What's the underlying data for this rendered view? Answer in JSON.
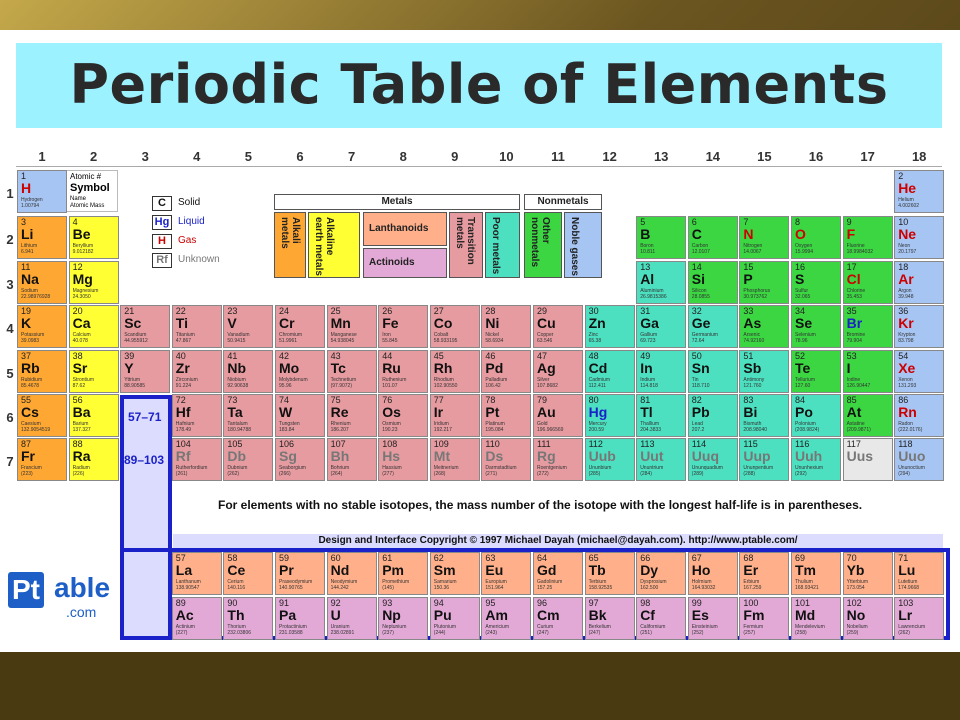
{
  "title": "Periodic Table of Elements",
  "groups": [
    "1",
    "2",
    "3",
    "4",
    "5",
    "6",
    "7",
    "8",
    "9",
    "10",
    "11",
    "12",
    "13",
    "14",
    "15",
    "16",
    "17",
    "18"
  ],
  "periods": [
    "1",
    "2",
    "3",
    "4",
    "5",
    "6",
    "7"
  ],
  "key": {
    "num": "Atomic #",
    "sym": "Symbol",
    "name": "Name",
    "mass": "Atomic Mass"
  },
  "states": [
    {
      "sym": "C",
      "label": "Solid",
      "color": "#111111"
    },
    {
      "sym": "Hg",
      "label": "Liquid",
      "color": "#1a21c8"
    },
    {
      "sym": "H",
      "label": "Gas",
      "color": "#cc0000"
    },
    {
      "sym": "Rf",
      "label": "Unknown",
      "color": "#777777"
    }
  ],
  "legend": {
    "metals": "Metals",
    "nonmetals": "Nonmetals",
    "alkali": "Alkali metals",
    "alkaline": "Alkaline earth metals",
    "lanthanoids": "Lanthanoids",
    "actinoids": "Actinoids",
    "transition": "Transition metals",
    "poor": "Poor metals",
    "other": "Other nonmetals",
    "noble": "Noble gases"
  },
  "lanthanide_range": "57–71",
  "actinide_range": "89–103",
  "note": "For elements with no stable isotopes, the mass number of the isotope with the longest half-life is in parentheses.",
  "copyright": "Design and Interface Copyright © 1997 Michael Dayah (michael@dayah.com). http://www.ptable.com/",
  "logo": {
    "pt": "Pt",
    "able": "able",
    "com": ".com"
  },
  "elements": [
    {
      "n": "1",
      "s": "H",
      "nm": "Hydrogen",
      "m": "1.00794",
      "g": 1,
      "p": 1,
      "c": "ng"
    },
    {
      "n": "2",
      "s": "He",
      "nm": "Helium",
      "m": "4.002602",
      "g": 18,
      "p": 1,
      "c": "ng"
    },
    {
      "n": "3",
      "s": "Li",
      "nm": "Lithium",
      "m": "6.941",
      "g": 1,
      "p": 2,
      "c": "alk"
    },
    {
      "n": "4",
      "s": "Be",
      "nm": "Beryllium",
      "m": "9.012182",
      "g": 2,
      "p": 2,
      "c": "ae"
    },
    {
      "n": "5",
      "s": "B",
      "nm": "Boron",
      "m": "10.811",
      "g": 13,
      "p": 2,
      "c": "nm2"
    },
    {
      "n": "6",
      "s": "C",
      "nm": "Carbon",
      "m": "12.0107",
      "g": 14,
      "p": 2,
      "c": "nm2"
    },
    {
      "n": "7",
      "s": "N",
      "nm": "Nitrogen",
      "m": "14.0067",
      "g": 15,
      "p": 2,
      "c": "nm2"
    },
    {
      "n": "8",
      "s": "O",
      "nm": "Oxygen",
      "m": "15.9994",
      "g": 16,
      "p": 2,
      "c": "nm2"
    },
    {
      "n": "9",
      "s": "F",
      "nm": "Fluorine",
      "m": "18.9984032",
      "g": 17,
      "p": 2,
      "c": "nm2"
    },
    {
      "n": "10",
      "s": "Ne",
      "nm": "Neon",
      "m": "20.1797",
      "g": 18,
      "p": 2,
      "c": "ng"
    },
    {
      "n": "11",
      "s": "Na",
      "nm": "Sodium",
      "m": "22.98976928",
      "g": 1,
      "p": 3,
      "c": "alk"
    },
    {
      "n": "12",
      "s": "Mg",
      "nm": "Magnesium",
      "m": "24.3050",
      "g": 2,
      "p": 3,
      "c": "ae"
    },
    {
      "n": "13",
      "s": "Al",
      "nm": "Aluminium",
      "m": "26.9815386",
      "g": 13,
      "p": 3,
      "c": "pm"
    },
    {
      "n": "14",
      "s": "Si",
      "nm": "Silicon",
      "m": "28.0855",
      "g": 14,
      "p": 3,
      "c": "nm2"
    },
    {
      "n": "15",
      "s": "P",
      "nm": "Phosphorus",
      "m": "30.973762",
      "g": 15,
      "p": 3,
      "c": "nm2"
    },
    {
      "n": "16",
      "s": "S",
      "nm": "Sulfur",
      "m": "32.065",
      "g": 16,
      "p": 3,
      "c": "nm2"
    },
    {
      "n": "17",
      "s": "Cl",
      "nm": "Chlorine",
      "m": "35.453",
      "g": 17,
      "p": 3,
      "c": "nm2"
    },
    {
      "n": "18",
      "s": "Ar",
      "nm": "Argon",
      "m": "39.948",
      "g": 18,
      "p": 3,
      "c": "ng"
    },
    {
      "n": "19",
      "s": "K",
      "nm": "Potassium",
      "m": "39.0983",
      "g": 1,
      "p": 4,
      "c": "alk"
    },
    {
      "n": "20",
      "s": "Ca",
      "nm": "Calcium",
      "m": "40.078",
      "g": 2,
      "p": 4,
      "c": "ae"
    },
    {
      "n": "21",
      "s": "Sc",
      "nm": "Scandium",
      "m": "44.955912",
      "g": 3,
      "p": 4,
      "c": "tm"
    },
    {
      "n": "22",
      "s": "Ti",
      "nm": "Titanium",
      "m": "47.867",
      "g": 4,
      "p": 4,
      "c": "tm"
    },
    {
      "n": "23",
      "s": "V",
      "nm": "Vanadium",
      "m": "50.9415",
      "g": 5,
      "p": 4,
      "c": "tm"
    },
    {
      "n": "24",
      "s": "Cr",
      "nm": "Chromium",
      "m": "51.9961",
      "g": 6,
      "p": 4,
      "c": "tm"
    },
    {
      "n": "25",
      "s": "Mn",
      "nm": "Manganese",
      "m": "54.938045",
      "g": 7,
      "p": 4,
      "c": "tm"
    },
    {
      "n": "26",
      "s": "Fe",
      "nm": "Iron",
      "m": "55.845",
      "g": 8,
      "p": 4,
      "c": "tm"
    },
    {
      "n": "27",
      "s": "Co",
      "nm": "Cobalt",
      "m": "58.933195",
      "g": 9,
      "p": 4,
      "c": "tm"
    },
    {
      "n": "28",
      "s": "Ni",
      "nm": "Nickel",
      "m": "58.6934",
      "g": 10,
      "p": 4,
      "c": "tm"
    },
    {
      "n": "29",
      "s": "Cu",
      "nm": "Copper",
      "m": "63.546",
      "g": 11,
      "p": 4,
      "c": "tm"
    },
    {
      "n": "30",
      "s": "Zn",
      "nm": "Zinc",
      "m": "65.38",
      "g": 12,
      "p": 4,
      "c": "pm"
    },
    {
      "n": "31",
      "s": "Ga",
      "nm": "Gallium",
      "m": "69.723",
      "g": 13,
      "p": 4,
      "c": "pm"
    },
    {
      "n": "32",
      "s": "Ge",
      "nm": "Germanium",
      "m": "72.64",
      "g": 14,
      "p": 4,
      "c": "pm"
    },
    {
      "n": "33",
      "s": "As",
      "nm": "Arsenic",
      "m": "74.92160",
      "g": 15,
      "p": 4,
      "c": "nm2"
    },
    {
      "n": "34",
      "s": "Se",
      "nm": "Selenium",
      "m": "78.96",
      "g": 16,
      "p": 4,
      "c": "nm2"
    },
    {
      "n": "35",
      "s": "Br",
      "nm": "Bromine",
      "m": "79.904",
      "g": 17,
      "p": 4,
      "c": "nm2"
    },
    {
      "n": "36",
      "s": "Kr",
      "nm": "Krypton",
      "m": "83.798",
      "g": 18,
      "p": 4,
      "c": "ng"
    },
    {
      "n": "37",
      "s": "Rb",
      "nm": "Rubidium",
      "m": "85.4678",
      "g": 1,
      "p": 5,
      "c": "alk"
    },
    {
      "n": "38",
      "s": "Sr",
      "nm": "Strontium",
      "m": "87.62",
      "g": 2,
      "p": 5,
      "c": "ae"
    },
    {
      "n": "39",
      "s": "Y",
      "nm": "Yttrium",
      "m": "88.90585",
      "g": 3,
      "p": 5,
      "c": "tm"
    },
    {
      "n": "40",
      "s": "Zr",
      "nm": "Zirconium",
      "m": "91.224",
      "g": 4,
      "p": 5,
      "c": "tm"
    },
    {
      "n": "41",
      "s": "Nb",
      "nm": "Niobium",
      "m": "92.90638",
      "g": 5,
      "p": 5,
      "c": "tm"
    },
    {
      "n": "42",
      "s": "Mo",
      "nm": "Molybdenum",
      "m": "95.96",
      "g": 6,
      "p": 5,
      "c": "tm"
    },
    {
      "n": "43",
      "s": "Tc",
      "nm": "Technetium",
      "m": "(97.9072)",
      "g": 7,
      "p": 5,
      "c": "tm"
    },
    {
      "n": "44",
      "s": "Ru",
      "nm": "Ruthenium",
      "m": "101.07",
      "g": 8,
      "p": 5,
      "c": "tm"
    },
    {
      "n": "45",
      "s": "Rh",
      "nm": "Rhodium",
      "m": "102.90550",
      "g": 9,
      "p": 5,
      "c": "tm"
    },
    {
      "n": "46",
      "s": "Pd",
      "nm": "Palladium",
      "m": "106.42",
      "g": 10,
      "p": 5,
      "c": "tm"
    },
    {
      "n": "47",
      "s": "Ag",
      "nm": "Silver",
      "m": "107.8682",
      "g": 11,
      "p": 5,
      "c": "tm"
    },
    {
      "n": "48",
      "s": "Cd",
      "nm": "Cadmium",
      "m": "112.411",
      "g": 12,
      "p": 5,
      "c": "pm"
    },
    {
      "n": "49",
      "s": "In",
      "nm": "Indium",
      "m": "114.818",
      "g": 13,
      "p": 5,
      "c": "pm"
    },
    {
      "n": "50",
      "s": "Sn",
      "nm": "Tin",
      "m": "118.710",
      "g": 14,
      "p": 5,
      "c": "pm"
    },
    {
      "n": "51",
      "s": "Sb",
      "nm": "Antimony",
      "m": "121.760",
      "g": 15,
      "p": 5,
      "c": "pm"
    },
    {
      "n": "52",
      "s": "Te",
      "nm": "Tellurium",
      "m": "127.60",
      "g": 16,
      "p": 5,
      "c": "nm2"
    },
    {
      "n": "53",
      "s": "I",
      "nm": "Iodine",
      "m": "126.90447",
      "g": 17,
      "p": 5,
      "c": "nm2"
    },
    {
      "n": "54",
      "s": "Xe",
      "nm": "Xenon",
      "m": "131.293",
      "g": 18,
      "p": 5,
      "c": "ng"
    },
    {
      "n": "55",
      "s": "Cs",
      "nm": "Caesium",
      "m": "132.9054519",
      "g": 1,
      "p": 6,
      "c": "alk"
    },
    {
      "n": "56",
      "s": "Ba",
      "nm": "Barium",
      "m": "137.327",
      "g": 2,
      "p": 6,
      "c": "ae"
    },
    {
      "n": "72",
      "s": "Hf",
      "nm": "Hafnium",
      "m": "178.49",
      "g": 4,
      "p": 6,
      "c": "tm"
    },
    {
      "n": "73",
      "s": "Ta",
      "nm": "Tantalum",
      "m": "180.94788",
      "g": 5,
      "p": 6,
      "c": "tm"
    },
    {
      "n": "74",
      "s": "W",
      "nm": "Tungsten",
      "m": "183.84",
      "g": 6,
      "p": 6,
      "c": "tm"
    },
    {
      "n": "75",
      "s": "Re",
      "nm": "Rhenium",
      "m": "186.207",
      "g": 7,
      "p": 6,
      "c": "tm"
    },
    {
      "n": "76",
      "s": "Os",
      "nm": "Osmium",
      "m": "190.23",
      "g": 8,
      "p": 6,
      "c": "tm"
    },
    {
      "n": "77",
      "s": "Ir",
      "nm": "Iridium",
      "m": "192.217",
      "g": 9,
      "p": 6,
      "c": "tm"
    },
    {
      "n": "78",
      "s": "Pt",
      "nm": "Platinum",
      "m": "195.084",
      "g": 10,
      "p": 6,
      "c": "tm"
    },
    {
      "n": "79",
      "s": "Au",
      "nm": "Gold",
      "m": "196.966569",
      "g": 11,
      "p": 6,
      "c": "tm"
    },
    {
      "n": "80",
      "s": "Hg",
      "nm": "Mercury",
      "m": "200.59",
      "g": 12,
      "p": 6,
      "c": "pm"
    },
    {
      "n": "81",
      "s": "Tl",
      "nm": "Thallium",
      "m": "204.3833",
      "g": 13,
      "p": 6,
      "c": "pm"
    },
    {
      "n": "82",
      "s": "Pb",
      "nm": "Lead",
      "m": "207.2",
      "g": 14,
      "p": 6,
      "c": "pm"
    },
    {
      "n": "83",
      "s": "Bi",
      "nm": "Bismuth",
      "m": "208.98040",
      "g": 15,
      "p": 6,
      "c": "pm"
    },
    {
      "n": "84",
      "s": "Po",
      "nm": "Polonium",
      "m": "(208.9824)",
      "g": 16,
      "p": 6,
      "c": "pm"
    },
    {
      "n": "85",
      "s": "At",
      "nm": "Astatine",
      "m": "(209.9871)",
      "g": 17,
      "p": 6,
      "c": "nm2"
    },
    {
      "n": "86",
      "s": "Rn",
      "nm": "Radon",
      "m": "(222.0176)",
      "g": 18,
      "p": 6,
      "c": "ng"
    },
    {
      "n": "87",
      "s": "Fr",
      "nm": "Francium",
      "m": "(223)",
      "g": 1,
      "p": 7,
      "c": "alk"
    },
    {
      "n": "88",
      "s": "Ra",
      "nm": "Radium",
      "m": "(226)",
      "g": 2,
      "p": 7,
      "c": "ae"
    },
    {
      "n": "104",
      "s": "Rf",
      "nm": "Rutherfordium",
      "m": "(261)",
      "g": 4,
      "p": 7,
      "c": "tm"
    },
    {
      "n": "105",
      "s": "Db",
      "nm": "Dubnium",
      "m": "(262)",
      "g": 5,
      "p": 7,
      "c": "tm"
    },
    {
      "n": "106",
      "s": "Sg",
      "nm": "Seaborgium",
      "m": "(266)",
      "g": 6,
      "p": 7,
      "c": "tm"
    },
    {
      "n": "107",
      "s": "Bh",
      "nm": "Bohrium",
      "m": "(264)",
      "g": 7,
      "p": 7,
      "c": "tm"
    },
    {
      "n": "108",
      "s": "Hs",
      "nm": "Hassium",
      "m": "(277)",
      "g": 8,
      "p": 7,
      "c": "tm"
    },
    {
      "n": "109",
      "s": "Mt",
      "nm": "Meitnerium",
      "m": "(268)",
      "g": 9,
      "p": 7,
      "c": "tm"
    },
    {
      "n": "110",
      "s": "Ds",
      "nm": "Darmstadtium",
      "m": "(271)",
      "g": 10,
      "p": 7,
      "c": "tm"
    },
    {
      "n": "111",
      "s": "Rg",
      "nm": "Roentgenium",
      "m": "(272)",
      "g": 11,
      "p": 7,
      "c": "tm"
    },
    {
      "n": "112",
      "s": "Uub",
      "nm": "Ununbium",
      "m": "(285)",
      "g": 12,
      "p": 7,
      "c": "pm"
    },
    {
      "n": "113",
      "s": "Uut",
      "nm": "Ununtrium",
      "m": "(284)",
      "g": 13,
      "p": 7,
      "c": "pm"
    },
    {
      "n": "114",
      "s": "Uuq",
      "nm": "Ununquadium",
      "m": "(289)",
      "g": 14,
      "p": 7,
      "c": "pm"
    },
    {
      "n": "115",
      "s": "Uup",
      "nm": "Ununpentium",
      "m": "(288)",
      "g": 15,
      "p": 7,
      "c": "pm"
    },
    {
      "n": "116",
      "s": "Uuh",
      "nm": "Ununhexium",
      "m": "(292)",
      "g": 16,
      "p": 7,
      "c": "pm"
    },
    {
      "n": "117",
      "s": "Uus",
      "nm": "",
      "m": "",
      "g": 17,
      "p": 7,
      "c": "unk"
    },
    {
      "n": "118",
      "s": "Uuo",
      "nm": "Ununoctium",
      "m": "(294)",
      "g": 18,
      "p": 7,
      "c": "ng"
    }
  ],
  "lanthanides": [
    {
      "n": "57",
      "s": "La",
      "nm": "Lanthanum",
      "m": "138.90547"
    },
    {
      "n": "58",
      "s": "Ce",
      "nm": "Cerium",
      "m": "140.116"
    },
    {
      "n": "59",
      "s": "Pr",
      "nm": "Praseodymium",
      "m": "140.90765"
    },
    {
      "n": "60",
      "s": "Nd",
      "nm": "Neodymium",
      "m": "144.242"
    },
    {
      "n": "61",
      "s": "Pm",
      "nm": "Promethium",
      "m": "(145)"
    },
    {
      "n": "62",
      "s": "Sm",
      "nm": "Samarium",
      "m": "150.36"
    },
    {
      "n": "63",
      "s": "Eu",
      "nm": "Europium",
      "m": "151.964"
    },
    {
      "n": "64",
      "s": "Gd",
      "nm": "Gadolinium",
      "m": "157.25"
    },
    {
      "n": "65",
      "s": "Tb",
      "nm": "Terbium",
      "m": "158.92535"
    },
    {
      "n": "66",
      "s": "Dy",
      "nm": "Dysprosium",
      "m": "162.500"
    },
    {
      "n": "67",
      "s": "Ho",
      "nm": "Holmium",
      "m": "164.93032"
    },
    {
      "n": "68",
      "s": "Er",
      "nm": "Erbium",
      "m": "167.259"
    },
    {
      "n": "69",
      "s": "Tm",
      "nm": "Thulium",
      "m": "168.93421"
    },
    {
      "n": "70",
      "s": "Yb",
      "nm": "Ytterbium",
      "m": "173.054"
    },
    {
      "n": "71",
      "s": "Lu",
      "nm": "Lutetium",
      "m": "174.9668"
    }
  ],
  "actinides": [
    {
      "n": "89",
      "s": "Ac",
      "nm": "Actinium",
      "m": "(227)"
    },
    {
      "n": "90",
      "s": "Th",
      "nm": "Thorium",
      "m": "232.03806"
    },
    {
      "n": "91",
      "s": "Pa",
      "nm": "Protactinium",
      "m": "231.03588"
    },
    {
      "n": "92",
      "s": "U",
      "nm": "Uranium",
      "m": "238.02891"
    },
    {
      "n": "93",
      "s": "Np",
      "nm": "Neptunium",
      "m": "(237)"
    },
    {
      "n": "94",
      "s": "Pu",
      "nm": "Plutonium",
      "m": "(244)"
    },
    {
      "n": "95",
      "s": "Am",
      "nm": "Americium",
      "m": "(243)"
    },
    {
      "n": "96",
      "s": "Cm",
      "nm": "Curium",
      "m": "(247)"
    },
    {
      "n": "97",
      "s": "Bk",
      "nm": "Berkelium",
      "m": "(247)"
    },
    {
      "n": "98",
      "s": "Cf",
      "nm": "Californium",
      "m": "(251)"
    },
    {
      "n": "99",
      "s": "Es",
      "nm": "Einsteinium",
      "m": "(252)"
    },
    {
      "n": "100",
      "s": "Fm",
      "nm": "Fermium",
      "m": "(257)"
    },
    {
      "n": "101",
      "s": "Md",
      "nm": "Mendelevium",
      "m": "(258)"
    },
    {
      "n": "102",
      "s": "No",
      "nm": "Nobelium",
      "m": "(259)"
    },
    {
      "n": "103",
      "s": "Lr",
      "nm": "Lawrencium",
      "m": "(262)"
    }
  ]
}
